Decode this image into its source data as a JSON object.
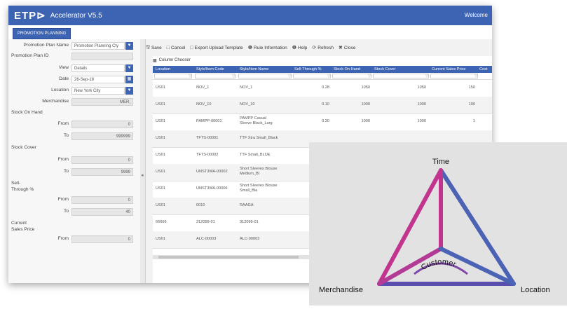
{
  "app": {
    "logo": "ETP⊳",
    "title": "Accelerator V5.5",
    "welcome": "Welcome",
    "module_tab": "PROMOTION PLANNING"
  },
  "filters": {
    "promotion_plan_name": {
      "label": "Promotion Plan Name",
      "value": "Promotion Planning Cty"
    },
    "promotion_plan_id": {
      "label": "Promotion Plan ID",
      "value": ""
    },
    "view": {
      "label": "View",
      "value": "Details"
    },
    "date": {
      "label": "Date",
      "value": "26-Sep-18"
    },
    "location": {
      "label": "Location",
      "value": "New York City"
    },
    "merchandise": {
      "label": "Merchandise",
      "value": "MER,"
    },
    "stock_on_hand": {
      "label": "Stock On Hand",
      "from_label": "From",
      "from": "0",
      "to_label": "To",
      "to": "999999"
    },
    "stock_cover": {
      "label": "Stock Cover",
      "from_label": "From",
      "from": "0",
      "to_label": "To",
      "to": "9999"
    },
    "sell_through": {
      "label": "Sell-Through %",
      "from_label": "From",
      "from": "0",
      "to_label": "To",
      "to": "40"
    },
    "current_sales_price": {
      "label": "Current Sales Price",
      "from_label": "From",
      "from": "0"
    }
  },
  "toolbar": {
    "save": "Save",
    "cancel": "Cancel",
    "export": "Export Upload Template",
    "rule_info": "Rule Information",
    "help": "Help",
    "refresh": "Refresh",
    "close": "Close"
  },
  "grid": {
    "column_chooser": "Column Chooser",
    "columns": [
      "Location",
      "Style/Item Code",
      "Style/Item Name",
      "Sell-Through %",
      "Stock On Hand",
      "Stock Cover",
      "Current Sales Price",
      "Cost"
    ],
    "rows": [
      [
        "US01",
        "NOV_1",
        "NOV_1",
        "0.28",
        "1050",
        "1050",
        "150"
      ],
      [
        "US01",
        "NOV_10",
        "NOV_10",
        "0.10",
        "1000",
        "1000",
        "100"
      ],
      [
        "US01",
        "PAMPP-00001",
        "PAMPP Casual Sleeve Black_Larg",
        "0.30",
        "1000",
        "1000",
        "1"
      ],
      [
        "US01",
        "TFTS-00001",
        "TTF Xtra Small_Black",
        "",
        "",
        "",
        ""
      ],
      [
        "US01",
        "TFTS-00002",
        "TTF Small_BLUE",
        "",
        "",
        "",
        ""
      ],
      [
        "US01",
        "UNST3WA-00002",
        "Short Sleeves Blouse Medium_Bl",
        "",
        "",
        "",
        ""
      ],
      [
        "US01",
        "UNST3WA-00006",
        "Short Sleeves Blouse Small_Bla",
        "",
        "",
        "",
        ""
      ],
      [
        "US01",
        "0010",
        "RAAGA",
        "",
        "",
        "",
        ""
      ],
      [
        "66666",
        "312099-01",
        "312099-01",
        "",
        "",
        "",
        ""
      ],
      [
        "US01",
        "ALC-00003",
        "ALC-00003",
        "",
        "",
        "",
        ""
      ]
    ]
  },
  "diagram": {
    "top": "Time",
    "left": "Merchandise",
    "right": "Location",
    "center": "Customer",
    "colors": {
      "pink": "#c2358f",
      "blue": "#4a63b5",
      "purple": "#7d47a7"
    }
  }
}
